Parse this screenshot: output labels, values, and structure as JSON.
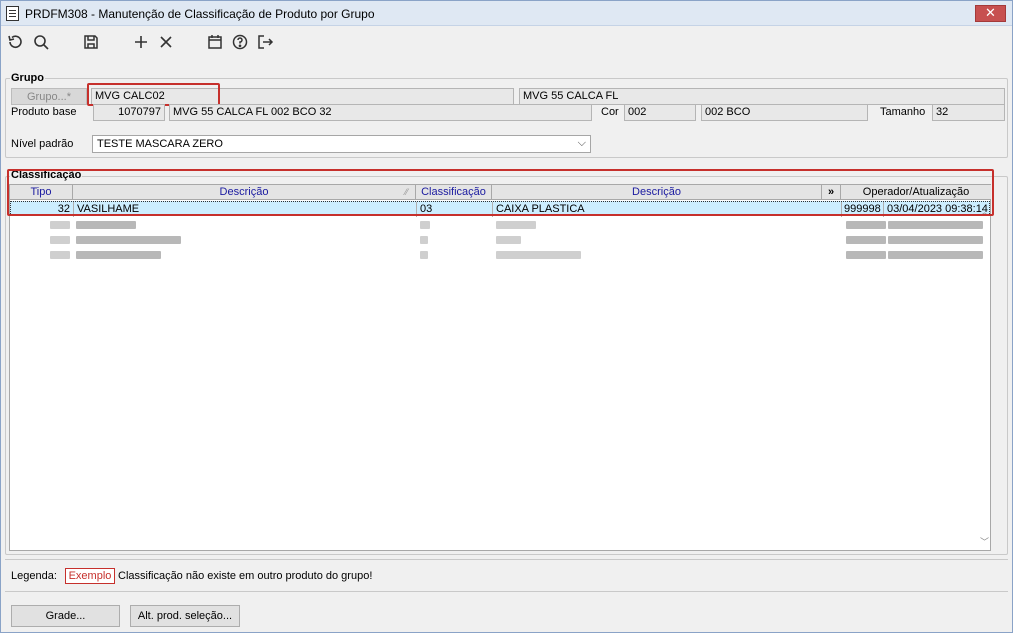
{
  "window": {
    "title": "PRDFM308 - Manutenção de Classificação de Produto por Grupo",
    "close_label": "✕"
  },
  "toolbar": {
    "icons": [
      "undo-icon",
      "search-icon",
      "save-icon",
      "add-icon",
      "delete-icon",
      "calendar-icon",
      "help-icon",
      "exit-icon"
    ]
  },
  "grupo": {
    "section_label": "Grupo",
    "grupo_button": "Grupo...*",
    "grupo_code": "MVG CALC02",
    "grupo_desc": "MVG 55 CALCA FL",
    "produto_base_label": "Produto base",
    "produto_code": "1070797",
    "produto_desc": "MVG 55 CALCA FL 002 BCO 32",
    "cor_label": "Cor",
    "cor_code": "002",
    "cor_desc": "002 BCO",
    "tamanho_label": "Tamanho",
    "tamanho_value": "32",
    "nivel_label": "Nível padrão",
    "nivel_value": "TESTE MASCARA ZERO"
  },
  "classificacao": {
    "section_label": "Classificação",
    "columns": {
      "tipo": "Tipo",
      "descricao1": "Descrição",
      "classificacao": "Classificação",
      "descricao2": "Descrição",
      "more": "»",
      "operador": "Operador/Atualização"
    },
    "selected_row": {
      "tipo": "32",
      "descricao": "VASILHAME",
      "classificacao": "03",
      "descricao2": "CAIXA PLASTICA",
      "operador": "999998",
      "atualizacao": "03/04/2023 09:38:14"
    }
  },
  "legend": {
    "label": "Legenda:",
    "example": "Exemplo",
    "text": "Classificação não existe em outro produto do grupo!"
  },
  "buttons": {
    "grade": "Grade...",
    "alt_prod": "Alt. prod. seleção..."
  },
  "colors": {
    "highlight": "#c6302c",
    "selected_row": "#cdeeff",
    "header_text": "#1a1aa0"
  }
}
